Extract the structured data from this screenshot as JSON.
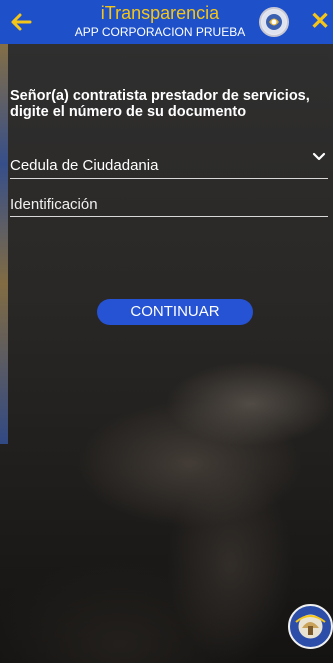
{
  "header": {
    "app_title": "iTransparencia",
    "app_subtitle": "APP CORPORACION PRUEBA",
    "back_icon": "arrow-left-icon",
    "close_icon": "close-icon",
    "close_glyph": "✕",
    "logo": "institution-logo",
    "colors": {
      "bar": "#1e51c9",
      "accent": "#f5c518"
    }
  },
  "form": {
    "prompt": "Señor(a) contratista prestador de servicios, digite  el número de su documento",
    "document_type": {
      "value": "Cedula de Ciudadania",
      "icon": "chevron-down-icon"
    },
    "identification": {
      "placeholder": "Identificación",
      "value": ""
    },
    "continue_label": "CONTINUAR",
    "button_color": "#2653d4"
  },
  "footer": {
    "badge": "brand-badge-logo"
  }
}
